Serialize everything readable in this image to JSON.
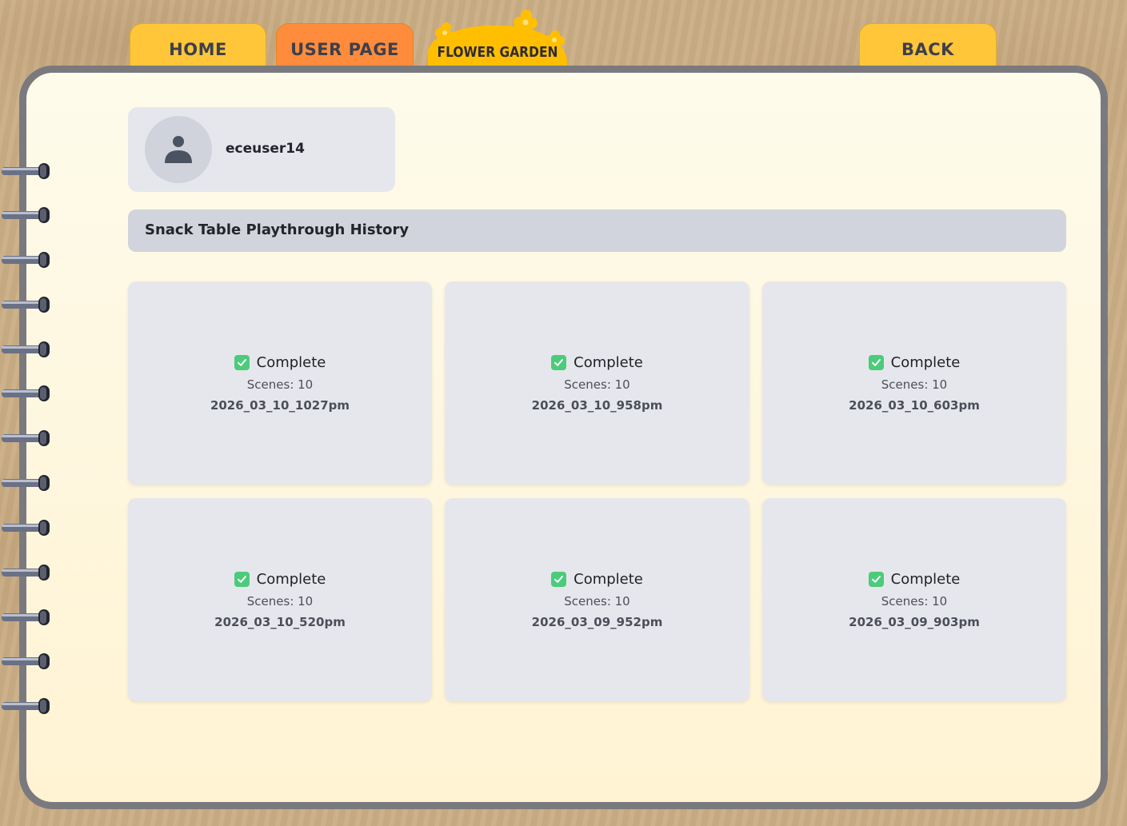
{
  "nav": {
    "home_label": "HOME",
    "user_page_label": "USER PAGE",
    "logo_text": "FLOWER GARDEN",
    "back_label": "BACK"
  },
  "profile": {
    "username": "eceuser14"
  },
  "history": {
    "title": "Snack Table Playthrough History",
    "cards": [
      {
        "status": "Complete",
        "scenes": "Scenes: 10",
        "date": "2026_03_10_1027pm"
      },
      {
        "status": "Complete",
        "scenes": "Scenes: 10",
        "date": "2026_03_10_958pm"
      },
      {
        "status": "Complete",
        "scenes": "Scenes: 10",
        "date": "2026_03_10_603pm"
      },
      {
        "status": "Complete",
        "scenes": "Scenes: 10",
        "date": "2026_03_10_520pm"
      },
      {
        "status": "Complete",
        "scenes": "Scenes: 10",
        "date": "2026_03_09_952pm"
      },
      {
        "status": "Complete",
        "scenes": "Scenes: 10",
        "date": "2026_03_09_903pm"
      }
    ]
  },
  "icons": {
    "avatar": "user-silhouette-icon",
    "status": "check-box-icon",
    "binding": "spiral-ring-icon"
  },
  "colors": {
    "tab_yellow": "#ffc63a",
    "tab_orange": "#ff8c3c",
    "logo_yellow": "#ffbf00",
    "complete_green": "#4ccb7b",
    "card_bg": "#e6e7ec"
  }
}
